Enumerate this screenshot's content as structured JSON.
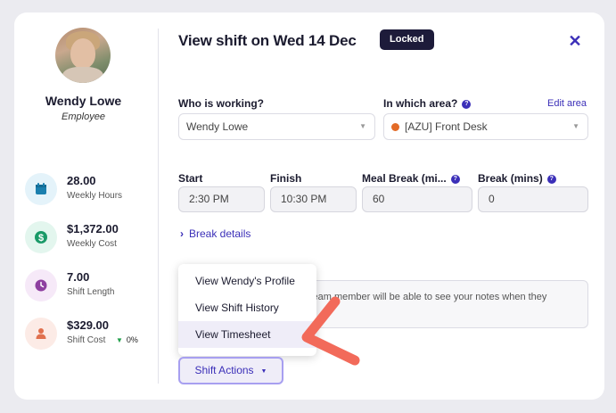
{
  "profile": {
    "name": "Wendy Lowe",
    "role": "Employee"
  },
  "stats": [
    {
      "value": "28.00",
      "label": "Weekly Hours",
      "icon": "calendar-icon",
      "color": "#1a7fae",
      "bg": "#e4f3fa"
    },
    {
      "value": "$1,372.00",
      "label": "Weekly Cost",
      "icon": "dollar-icon",
      "color": "#1a9a68",
      "bg": "#e3f6ee"
    },
    {
      "value": "7.00",
      "label": "Shift Length",
      "icon": "clock-icon",
      "color": "#8e3fa0",
      "bg": "#f6e9f8"
    },
    {
      "value": "$329.00",
      "label": "Shift Cost",
      "icon": "person-icon",
      "color": "#e0704e",
      "bg": "#fcebe6",
      "trend": "0%"
    }
  ],
  "header": {
    "title": "View shift on Wed 14 Dec",
    "badge": "Locked",
    "close_icon": "close-icon"
  },
  "form": {
    "who_label": "Who is working?",
    "who_value": "Wendy Lowe",
    "area_label": "In which area?",
    "area_link": "Edit area",
    "area_value": "[AZU] Front Desk",
    "area_color": "#e36b27",
    "start_label": "Start",
    "start_value": "2:30 PM",
    "finish_label": "Finish",
    "finish_value": "10:30 PM",
    "meal_label": "Meal Break (mi...",
    "meal_value": "60",
    "break_label": "Break (mins)",
    "break_value": "0",
    "break_details": "Break details",
    "notes_text": "Team member will be able to see your notes when they"
  },
  "menu": {
    "items": [
      "View Wendy's Profile",
      "View Shift History",
      "View Timesheet"
    ],
    "active_index": 2
  },
  "actions": {
    "shift_actions_label": "Shift Actions"
  },
  "colors": {
    "accent": "#3b2fb8",
    "annotation_arrow": "#f26a5a"
  }
}
